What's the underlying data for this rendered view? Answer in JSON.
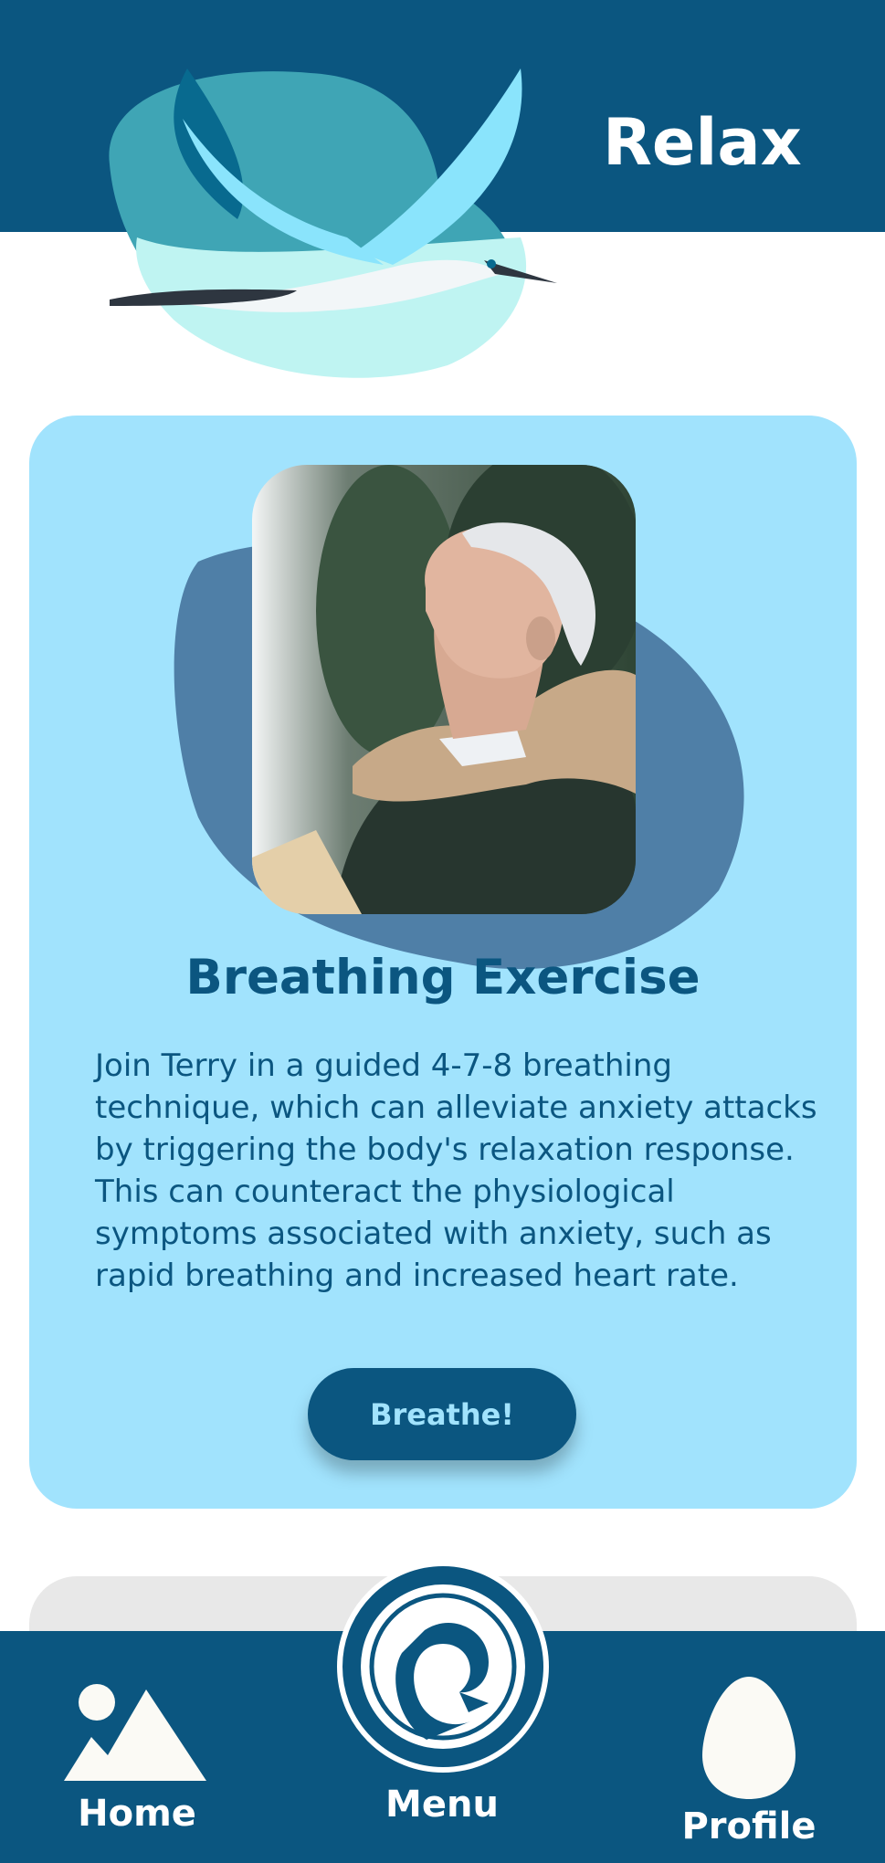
{
  "header": {
    "title": "Relax",
    "logo_icon": "flying-bird-logo",
    "background_color": "#0b5680"
  },
  "card": {
    "image_description_icon": "man-breathing-photo",
    "title": "Breathing Exercise",
    "description": "Join Terry in a guided 4-7-8 breathing technique, which can alleviate anxiety attacks by triggering the body's relaxation response. This can counteract the physiological symptoms associated with anxiety, such as rapid breathing and increased heart rate.",
    "button_label": "Breathe!",
    "background_color": "#a1e3fd",
    "accent_color": "#0b5680"
  },
  "bottom_nav": {
    "home_label": "Home",
    "menu_label": "Menu",
    "profile_label": "Profile",
    "home_icon": "mountain-sun-icon",
    "menu_icon": "bird-circle-icon",
    "profile_icon": "egg-icon"
  }
}
